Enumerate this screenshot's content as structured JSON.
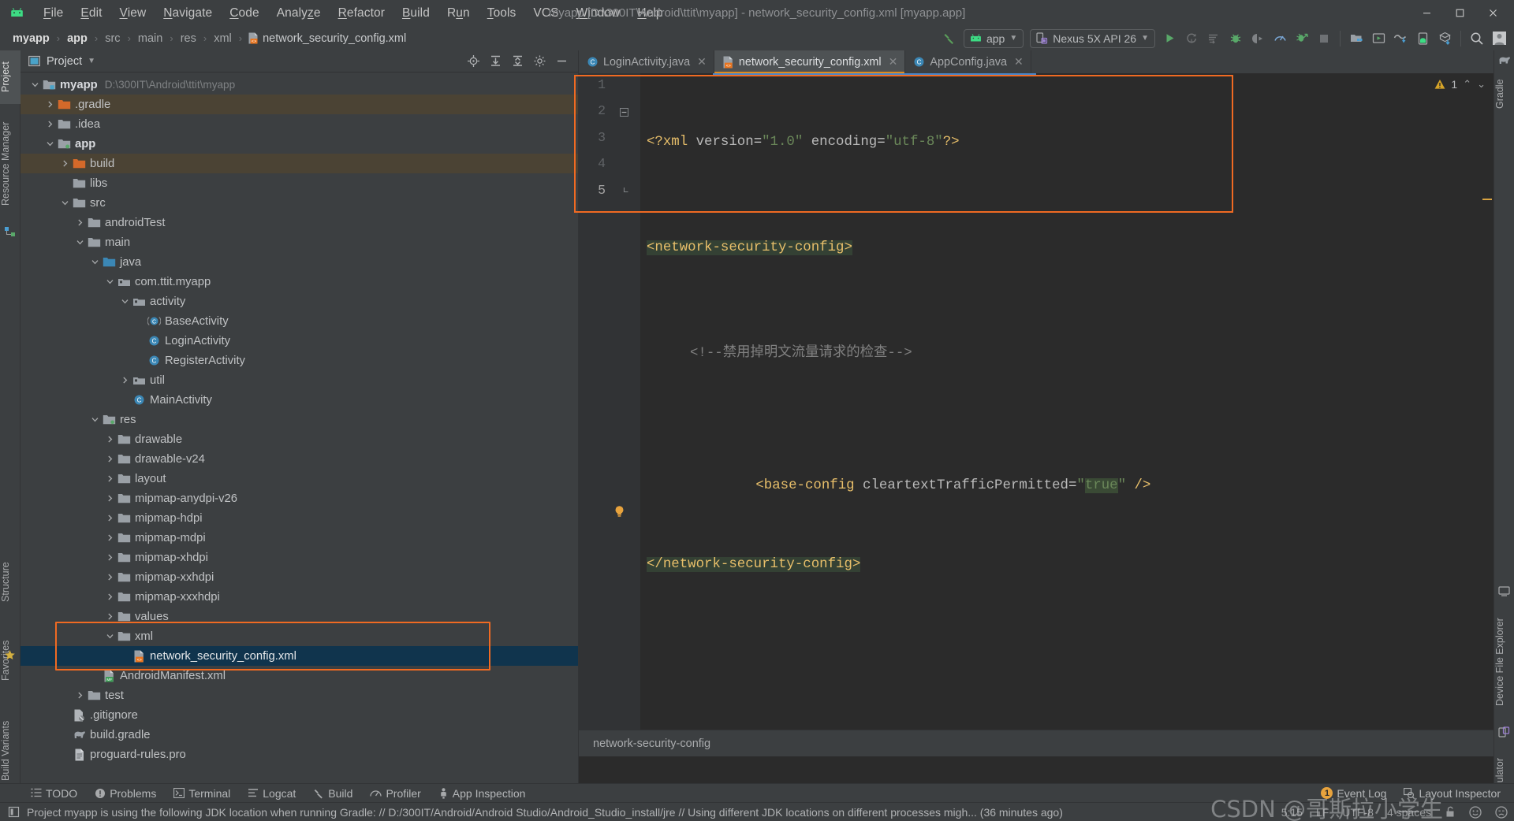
{
  "window": {
    "title": "myapp [D:\\300IT\\Android\\ttit\\myapp] - network_security_config.xml [myapp.app]",
    "minimize": "–",
    "maximize": "❐",
    "close": "✕"
  },
  "menu": {
    "items": [
      {
        "label": "File",
        "mnemonic": "F"
      },
      {
        "label": "Edit",
        "mnemonic": "E"
      },
      {
        "label": "View",
        "mnemonic": "V"
      },
      {
        "label": "Navigate",
        "mnemonic": "N"
      },
      {
        "label": "Code",
        "mnemonic": "C"
      },
      {
        "label": "Analyze",
        "mnemonic": "z"
      },
      {
        "label": "Refactor",
        "mnemonic": "R"
      },
      {
        "label": "Build",
        "mnemonic": "B"
      },
      {
        "label": "Run",
        "mnemonic": "u"
      },
      {
        "label": "Tools",
        "mnemonic": "T"
      },
      {
        "label": "VCS",
        "mnemonic": ""
      },
      {
        "label": "Window",
        "mnemonic": "W"
      },
      {
        "label": "Help",
        "mnemonic": "H"
      }
    ]
  },
  "breadcrumbs": {
    "items": [
      "myapp",
      "app",
      "src",
      "main",
      "res",
      "xml",
      "network_security_config.xml"
    ],
    "separator": "›"
  },
  "toolbar": {
    "build_hammer": "build-icon",
    "module_selector": "app",
    "device_selector": "Nexus 5X API 26",
    "actions": [
      "run-button",
      "rerun-button",
      "run-with-coverage-button",
      "debug-button",
      "attach-debugger-button",
      "profiler-button",
      "apply-changes-button",
      "stop-button",
      "sdk-manager-button",
      "avd-manager-button",
      "layout-inspector-button",
      "device-manager-button",
      "gradle-sync-button",
      "search-everywhere-button",
      "avatar-button"
    ]
  },
  "left_tool_strip": {
    "top_items": [
      "Project",
      "Resource Manager"
    ],
    "bottom_items": [
      "Structure",
      "Favorites",
      "Build Variants"
    ]
  },
  "right_tool_strip": {
    "top_items": [
      "Gradle"
    ],
    "bottom_items": [
      "Device File Explorer",
      "Emulator"
    ]
  },
  "project_panel": {
    "title": "Project",
    "dropdown": "▾",
    "header_actions": [
      "select-opened-file-icon",
      "expand-all-icon",
      "collapse-all-icon",
      "settings-icon",
      "hide-icon"
    ],
    "tree": [
      {
        "depth": 0,
        "arrow": "expanded",
        "icon": "module-folder",
        "label": "myapp",
        "sub": "D:\\300IT\\Android\\ttit\\myapp",
        "bold": true,
        "state": "normal"
      },
      {
        "depth": 1,
        "arrow": "collapsed",
        "icon": "folder-orange",
        "label": ".gradle",
        "sub": "",
        "bold": false,
        "state": "excluded"
      },
      {
        "depth": 1,
        "arrow": "collapsed",
        "icon": "folder",
        "label": ".idea",
        "sub": "",
        "bold": false,
        "state": "normal"
      },
      {
        "depth": 1,
        "arrow": "expanded",
        "icon": "module-folder-green",
        "label": "app",
        "sub": "",
        "bold": true,
        "state": "normal"
      },
      {
        "depth": 2,
        "arrow": "collapsed",
        "icon": "folder-orange",
        "label": "build",
        "sub": "",
        "bold": false,
        "state": "excluded"
      },
      {
        "depth": 2,
        "arrow": "none",
        "icon": "folder",
        "label": "libs",
        "sub": "",
        "bold": false,
        "state": "normal"
      },
      {
        "depth": 2,
        "arrow": "expanded",
        "icon": "folder",
        "label": "src",
        "sub": "",
        "bold": false,
        "state": "normal"
      },
      {
        "depth": 3,
        "arrow": "collapsed",
        "icon": "folder",
        "label": "androidTest",
        "sub": "",
        "bold": false,
        "state": "normal"
      },
      {
        "depth": 3,
        "arrow": "expanded",
        "icon": "folder",
        "label": "main",
        "sub": "",
        "bold": false,
        "state": "normal"
      },
      {
        "depth": 4,
        "arrow": "expanded",
        "icon": "folder-source",
        "label": "java",
        "sub": "",
        "bold": false,
        "state": "normal"
      },
      {
        "depth": 5,
        "arrow": "expanded",
        "icon": "package",
        "label": "com.ttit.myapp",
        "sub": "",
        "bold": false,
        "state": "normal"
      },
      {
        "depth": 6,
        "arrow": "expanded",
        "icon": "package",
        "label": "activity",
        "sub": "",
        "bold": false,
        "state": "normal"
      },
      {
        "depth": 7,
        "arrow": "none",
        "icon": "class-abstract",
        "label": "BaseActivity",
        "sub": "",
        "bold": false,
        "state": "normal"
      },
      {
        "depth": 7,
        "arrow": "none",
        "icon": "class",
        "label": "LoginActivity",
        "sub": "",
        "bold": false,
        "state": "normal"
      },
      {
        "depth": 7,
        "arrow": "none",
        "icon": "class",
        "label": "RegisterActivity",
        "sub": "",
        "bold": false,
        "state": "normal"
      },
      {
        "depth": 6,
        "arrow": "collapsed",
        "icon": "package",
        "label": "util",
        "sub": "",
        "bold": false,
        "state": "normal"
      },
      {
        "depth": 6,
        "arrow": "none",
        "icon": "class",
        "label": "MainActivity",
        "sub": "",
        "bold": false,
        "state": "normal"
      },
      {
        "depth": 4,
        "arrow": "expanded",
        "icon": "folder-res",
        "label": "res",
        "sub": "",
        "bold": false,
        "state": "normal"
      },
      {
        "depth": 5,
        "arrow": "collapsed",
        "icon": "folder",
        "label": "drawable",
        "sub": "",
        "bold": false,
        "state": "normal"
      },
      {
        "depth": 5,
        "arrow": "collapsed",
        "icon": "folder",
        "label": "drawable-v24",
        "sub": "",
        "bold": false,
        "state": "normal"
      },
      {
        "depth": 5,
        "arrow": "collapsed",
        "icon": "folder",
        "label": "layout",
        "sub": "",
        "bold": false,
        "state": "normal"
      },
      {
        "depth": 5,
        "arrow": "collapsed",
        "icon": "folder",
        "label": "mipmap-anydpi-v26",
        "sub": "",
        "bold": false,
        "state": "normal"
      },
      {
        "depth": 5,
        "arrow": "collapsed",
        "icon": "folder",
        "label": "mipmap-hdpi",
        "sub": "",
        "bold": false,
        "state": "normal"
      },
      {
        "depth": 5,
        "arrow": "collapsed",
        "icon": "folder",
        "label": "mipmap-mdpi",
        "sub": "",
        "bold": false,
        "state": "normal"
      },
      {
        "depth": 5,
        "arrow": "collapsed",
        "icon": "folder",
        "label": "mipmap-xhdpi",
        "sub": "",
        "bold": false,
        "state": "normal"
      },
      {
        "depth": 5,
        "arrow": "collapsed",
        "icon": "folder",
        "label": "mipmap-xxhdpi",
        "sub": "",
        "bold": false,
        "state": "normal"
      },
      {
        "depth": 5,
        "arrow": "collapsed",
        "icon": "folder",
        "label": "mipmap-xxxhdpi",
        "sub": "",
        "bold": false,
        "state": "normal"
      },
      {
        "depth": 5,
        "arrow": "collapsed",
        "icon": "folder",
        "label": "values",
        "sub": "",
        "bold": false,
        "state": "normal"
      },
      {
        "depth": 5,
        "arrow": "expanded",
        "icon": "folder",
        "label": "xml",
        "sub": "",
        "bold": false,
        "state": "normal"
      },
      {
        "depth": 6,
        "arrow": "none",
        "icon": "xml-file",
        "label": "network_security_config.xml",
        "sub": "",
        "bold": false,
        "state": "selected"
      },
      {
        "depth": 4,
        "arrow": "none",
        "icon": "manifest-file",
        "label": "AndroidManifest.xml",
        "sub": "",
        "bold": false,
        "state": "normal"
      },
      {
        "depth": 3,
        "arrow": "collapsed",
        "icon": "folder",
        "label": "test",
        "sub": "",
        "bold": false,
        "state": "normal"
      },
      {
        "depth": 2,
        "arrow": "none",
        "icon": "gitignore-file",
        "label": ".gitignore",
        "sub": "",
        "bold": false,
        "state": "normal"
      },
      {
        "depth": 2,
        "arrow": "none",
        "icon": "gradle-file",
        "label": "build.gradle",
        "sub": "",
        "bold": false,
        "state": "normal"
      },
      {
        "depth": 2,
        "arrow": "none",
        "icon": "text-file",
        "label": "proguard-rules.pro",
        "sub": "",
        "bold": false,
        "state": "normal"
      }
    ]
  },
  "editor": {
    "tabs": [
      {
        "label": "LoginActivity.java",
        "icon": "java-class-icon",
        "active": false,
        "close": "✕"
      },
      {
        "label": "network_security_config.xml",
        "icon": "xml-file-icon",
        "active": true,
        "close": "✕"
      },
      {
        "label": "AppConfig.java",
        "icon": "java-class-icon",
        "active": false,
        "close": "✕"
      }
    ],
    "line_numbers": [
      "1",
      "2",
      "3",
      "4",
      "5"
    ],
    "code": {
      "line1": {
        "decl_open": "<?xml ",
        "attr1": "version",
        "eq": "=",
        "val1": "\"1.0\"",
        "attr2": " encoding",
        "val2": "\"utf-8\"",
        "decl_close": "?>"
      },
      "line2": "<network-security-config>",
      "line3": "<!--禁用掉明文流量请求的检查-->",
      "line4": {
        "tag": "<base-config ",
        "attr": "cleartextTrafficPermitted",
        "eq": "=",
        "quote": "\"",
        "value": "true",
        "quote2": "\"",
        "selfclose": " />"
      },
      "line5": "</network-security-config>"
    },
    "inspection": {
      "warning_count": "1",
      "warning_icon": "warning-triangle-icon"
    },
    "breadcrumb": "network-security-config"
  },
  "bottom_tools": {
    "items": [
      {
        "label": "TODO",
        "icon": "todo-icon"
      },
      {
        "label": "Problems",
        "icon": "problems-icon"
      },
      {
        "label": "Terminal",
        "icon": "terminal-icon"
      },
      {
        "label": "Logcat",
        "icon": "logcat-icon"
      },
      {
        "label": "Build",
        "icon": "build-hammer-icon"
      },
      {
        "label": "Profiler",
        "icon": "profiler-icon"
      },
      {
        "label": "App Inspection",
        "icon": "app-inspection-icon"
      }
    ],
    "right_items": [
      {
        "label": "Event Log",
        "icon": "event-log-icon",
        "badge": "1"
      },
      {
        "label": "Layout Inspector",
        "icon": "layout-inspector-icon",
        "badge": ""
      }
    ]
  },
  "status_bar": {
    "message": "Project myapp is using the following JDK location when running Gradle: // D:/300IT/Android/Android Studio/Android_Studio_install/jre // Using different JDK locations on different processes migh... (36 minutes ago)",
    "caret": "5:15",
    "line_separator": "LF",
    "encoding": "UTF-8",
    "indent": "4 spaces",
    "lock_icon": "unlocked-icon",
    "inspection_faces": [
      "inspection-ok-icon",
      "inspection-warn-icon"
    ]
  },
  "watermark": "CSDN @哥斯拉小学生",
  "colors": {
    "background": "#3c3f41",
    "editor_bg": "#2b2b2b",
    "accent_orange": "#f06a22",
    "selection_blue": "#10344d",
    "tag": "#e8bf6a",
    "string": "#6a8759",
    "comment": "#808080",
    "excluded": "#4b4334",
    "android_green": "#3ddc84"
  }
}
